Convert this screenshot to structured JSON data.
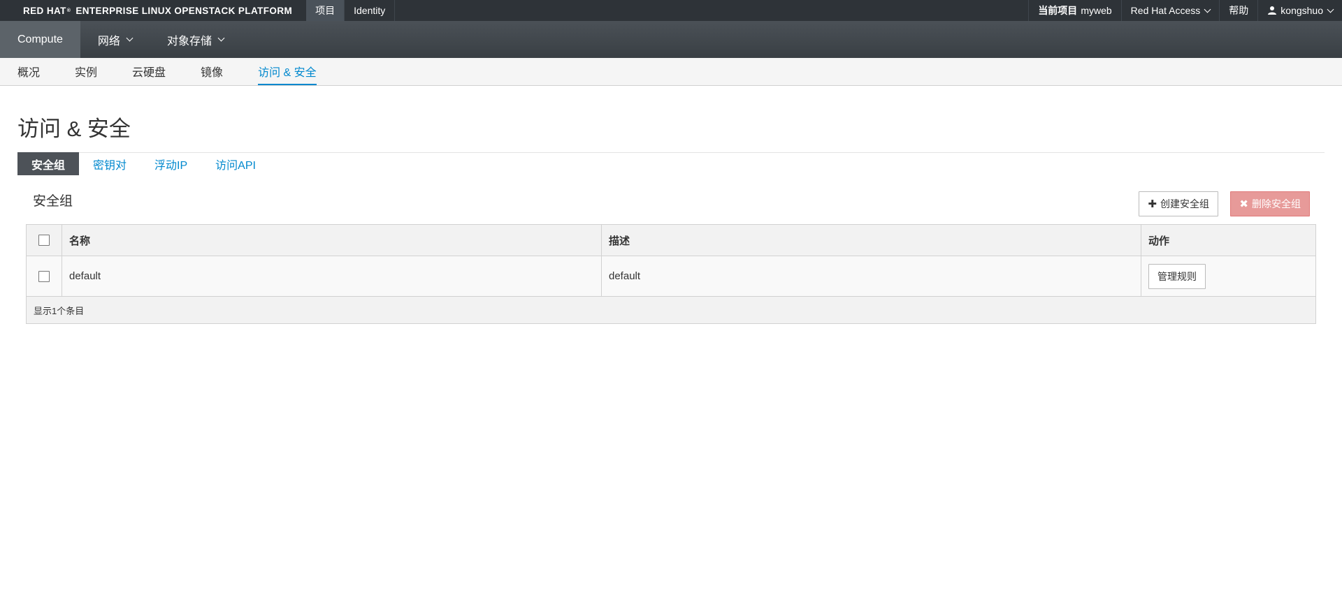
{
  "brand": {
    "part1": "RED HAT",
    "sup": "®",
    "part2": "ENTERPRISE LINUX OPENSTACK PLATFORM"
  },
  "top_tabs": [
    {
      "label": "项目",
      "active": true
    },
    {
      "label": "Identity",
      "active": false
    }
  ],
  "top_right": {
    "project_label": "当前项目",
    "project_value": "myweb",
    "access_label": "Red Hat Access",
    "help_label": "帮助",
    "user_label": "kongshuo"
  },
  "sec_tabs": [
    {
      "label": "Compute",
      "active": true
    },
    {
      "label": "网络",
      "active": false
    },
    {
      "label": "对象存储",
      "active": false
    }
  ],
  "tert_tabs": [
    {
      "label": "概况"
    },
    {
      "label": "实例"
    },
    {
      "label": "云硬盘"
    },
    {
      "label": "镜像"
    },
    {
      "label": "访问 & 安全",
      "active": true
    }
  ],
  "page": {
    "title": "访问 & 安全"
  },
  "sub_tabs": [
    {
      "label": "安全组",
      "active": true
    },
    {
      "label": "密钥对"
    },
    {
      "label": "浮动IP"
    },
    {
      "label": "访问API"
    }
  ],
  "section": {
    "title": "安全组",
    "create_label": "创建安全组",
    "delete_label": "删除安全组"
  },
  "table": {
    "headers": {
      "name": "名称",
      "desc": "描述",
      "action": "动作"
    },
    "rows": [
      {
        "name": "default",
        "desc": "default",
        "action": "管理规则"
      }
    ],
    "footer": "显示1个条目"
  },
  "colors": {
    "accent": "#0088ce",
    "danger": "#e79a99",
    "topbar": "#2e3338"
  }
}
